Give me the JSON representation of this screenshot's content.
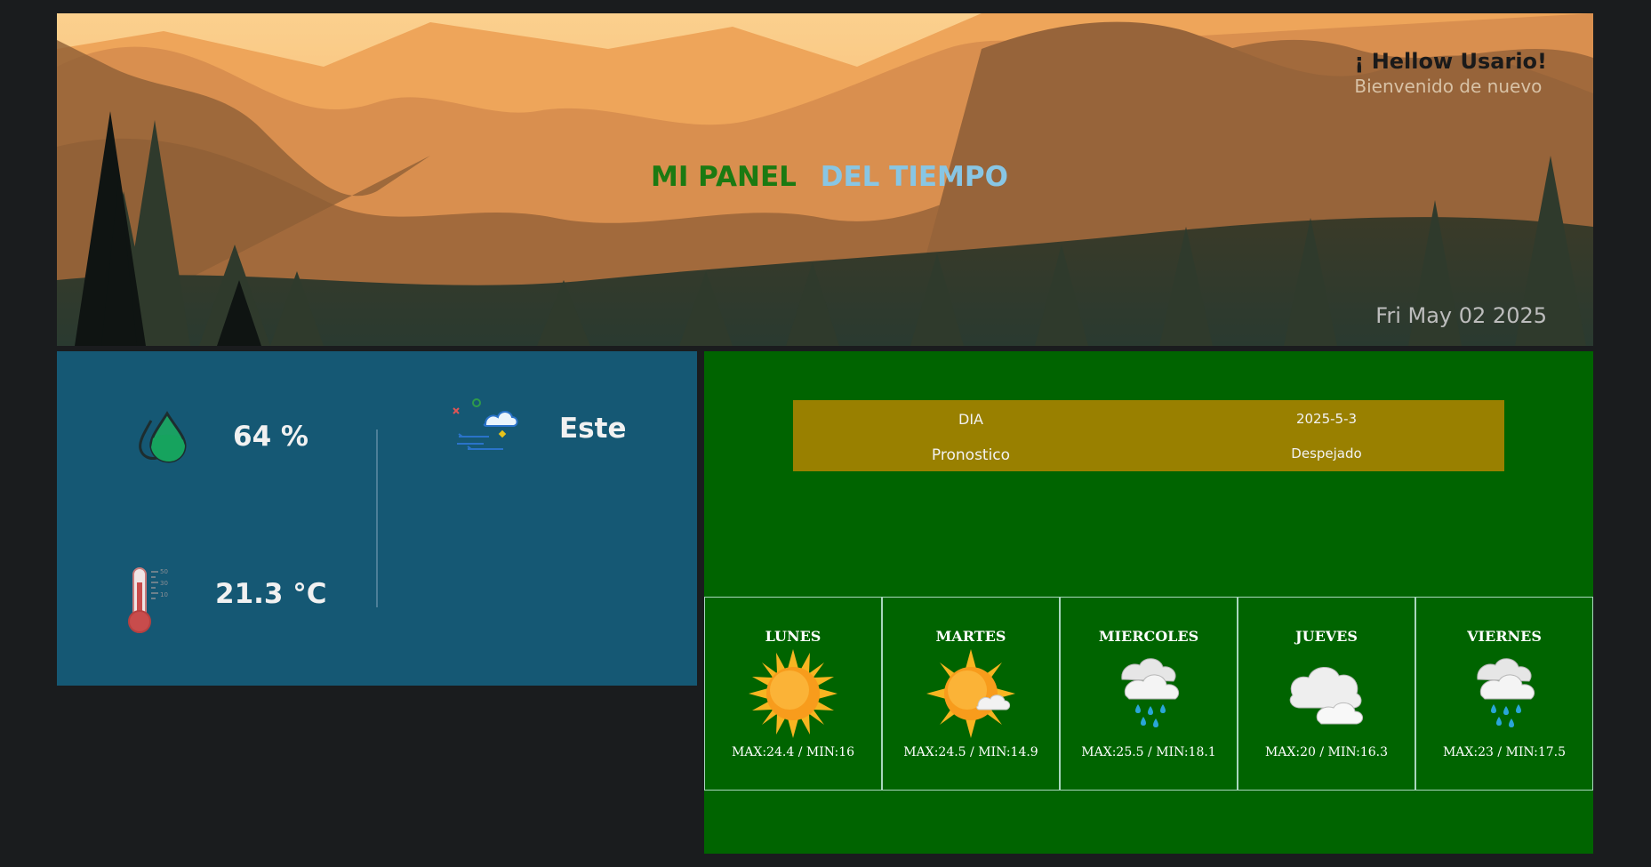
{
  "header": {
    "greeting": "¡ Hellow Usario!",
    "welcome": "Bienvenido de nuevo",
    "title_part1": "MI PANEL",
    "title_part2": "DEL TIEMPO",
    "date": "Fri May 02 2025"
  },
  "current": {
    "humidity": "64 %",
    "temperature": "21.3 °C",
    "wind_direction": "Este",
    "icons": [
      "humidity-drops-icon",
      "thermometer-icon",
      "wind-cloud-icon"
    ]
  },
  "forecast_table": {
    "day_label": "DIA",
    "day_value": "2025-5-3",
    "forecast_label": "Pronostico",
    "forecast_value": "Despejado"
  },
  "week": [
    {
      "name": "LUNES",
      "icon": "sun-icon",
      "range": "MAX:24.4 / MIN:16"
    },
    {
      "name": "MARTES",
      "icon": "sun-cloud-icon",
      "range": "MAX:24.5 / MIN:14.9"
    },
    {
      "name": "MIERCOLES",
      "icon": "rain-cloud-icon",
      "range": "MAX:25.5 / MIN:18.1"
    },
    {
      "name": "JUEVES",
      "icon": "cloud-icon",
      "range": "MAX:20 / MIN:16.3"
    },
    {
      "name": "VIERNES",
      "icon": "rain-cloud-icon",
      "range": "MAX:23 / MIN:17.5"
    }
  ],
  "colors": {
    "background": "#1a1c1e",
    "stats_panel": "#155874",
    "forecast_panel": "#006400",
    "table_bg": "#998000",
    "title_green": "#1b7a12",
    "title_blue": "#88c6e4"
  }
}
